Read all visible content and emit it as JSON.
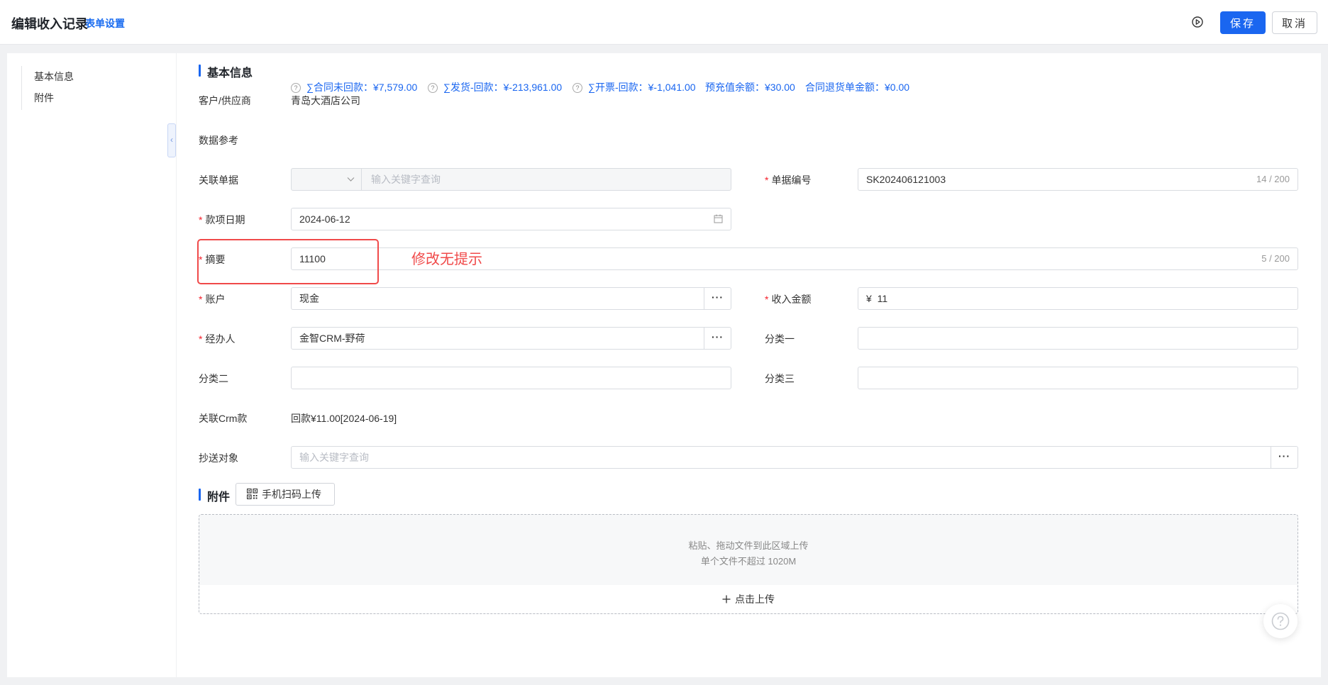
{
  "header": {
    "title": "编辑收入记录",
    "form_settings": "表单设置",
    "save": "保存",
    "cancel": "取消"
  },
  "sidebar": {
    "items": [
      {
        "label": "基本信息"
      },
      {
        "label": "附件"
      }
    ]
  },
  "basic_info": {
    "section_title": "基本信息",
    "customer": {
      "label": "客户/供应商",
      "value": "青岛大酒店公司"
    },
    "data_ref": {
      "label": "数据参考",
      "items": [
        "∑合同未回款：¥7,579.00",
        "∑发货-回款：¥-213,961.00",
        "∑开票-回款：¥-1,041.00",
        "预充值余额：¥30.00",
        "合同退货单金额：¥0.00"
      ]
    },
    "related_doc": {
      "label": "关联单据",
      "placeholder": "输入关键字查询"
    },
    "doc_number": {
      "label": "单据编号",
      "value": "SK202406121003",
      "counter": "14 / 200"
    },
    "payment_date": {
      "label": "款项日期",
      "value": "2024-06-12"
    },
    "summary": {
      "label": "摘要",
      "value": "11100",
      "counter": "5 / 200"
    },
    "account": {
      "label": "账户",
      "value": "现金"
    },
    "income_amount": {
      "label": "收入金额",
      "value": "¥  11"
    },
    "handler": {
      "label": "经办人",
      "value": "金智CRM-野荷"
    },
    "category1": {
      "label": "分类一",
      "value": ""
    },
    "category2": {
      "label": "分类二",
      "value": ""
    },
    "category3": {
      "label": "分类三",
      "value": ""
    },
    "related_crm": {
      "label": "关联Crm款",
      "value": "回款¥11.00[2024-06-19]"
    },
    "cc": {
      "label": "抄送对象",
      "placeholder": "输入关键字查询"
    }
  },
  "annotation": "修改无提示",
  "attachments": {
    "section_title": "附件",
    "scan_button": "手机扫码上传",
    "drop_hint": "粘贴、拖动文件到此区域上传",
    "size_hint": "单个文件不超过 1020M",
    "upload_label": "点击上传"
  },
  "colors": {
    "accent": "#1a66f0",
    "required": "#f5222d",
    "annotation": "#f04a4a"
  }
}
